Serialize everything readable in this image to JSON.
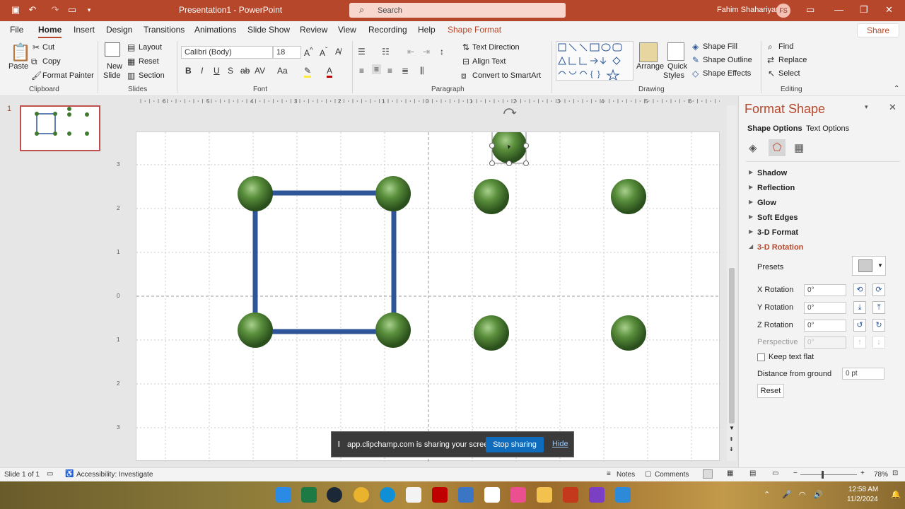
{
  "titlebar": {
    "title": "Presentation1  -  PowerPoint",
    "search_placeholder": "Search",
    "user_name": "Fahim Shahariyar",
    "user_initials": "FS"
  },
  "menu": {
    "tabs": [
      "File",
      "Home",
      "Insert",
      "Design",
      "Transitions",
      "Animations",
      "Slide Show",
      "Review",
      "View",
      "Recording",
      "Help",
      "Shape Format"
    ],
    "share": "Share"
  },
  "ribbon": {
    "clipboard": {
      "paste": "Paste",
      "cut": "Cut",
      "copy": "Copy",
      "format_painter": "Format Painter",
      "group": "Clipboard"
    },
    "slides": {
      "new_slide": "New",
      "new_slide2": "Slide",
      "layout": "Layout",
      "reset": "Reset",
      "section": "Section",
      "group": "Slides"
    },
    "font": {
      "name": "Calibri (Body)",
      "size": "18",
      "group": "Font"
    },
    "paragraph": {
      "text_direction": "Text Direction",
      "align_text": "Align Text",
      "convert_smartart": "Convert to SmartArt",
      "group": "Paragraph"
    },
    "drawing": {
      "arrange": "Arrange",
      "quick_styles": "Quick",
      "quick_styles2": "Styles",
      "shape_fill": "Shape Fill",
      "shape_outline": "Shape Outline",
      "shape_effects": "Shape Effects",
      "group": "Drawing"
    },
    "editing": {
      "find": "Find",
      "replace": "Replace",
      "select": "Select",
      "group": "Editing"
    }
  },
  "thumbnails": {
    "slide_number": "1"
  },
  "rulers": {
    "h_ticks": [
      "6",
      "5",
      "4",
      "3",
      "2",
      "1",
      "0",
      "1",
      "2",
      "3",
      "4",
      "5",
      "6"
    ],
    "v_ticks": [
      "3",
      "2",
      "1",
      "0",
      "1",
      "2",
      "3"
    ]
  },
  "format_pane": {
    "title": "Format Shape",
    "tabs": [
      "Shape Options",
      "Text Options"
    ],
    "sections": [
      "Shadow",
      "Reflection",
      "Glow",
      "Soft Edges",
      "3-D Format",
      "3-D Rotation"
    ],
    "presets_label": "Presets",
    "x_rotation": {
      "label": "X Rotation",
      "value": "0°"
    },
    "y_rotation": {
      "label": "Y Rotation",
      "value": "0°"
    },
    "z_rotation": {
      "label": "Z Rotation",
      "value": "0°"
    },
    "perspective": {
      "label": "Perspective",
      "value": "0°"
    },
    "keep_text_flat": "Keep text flat",
    "distance_label": "Distance from ground",
    "distance_value": "0 pt",
    "reset": "Reset"
  },
  "notification": {
    "message": "app.clipchamp.com is sharing your screen.",
    "stop": "Stop sharing",
    "hide": "Hide"
  },
  "statusbar": {
    "slide_info": "Slide 1 of 1",
    "accessibility": "Accessibility: Investigate",
    "notes": "Notes",
    "comments": "Comments",
    "zoom": "78%"
  },
  "taskbar": {
    "time": "12:58 AM",
    "date": "11/2/2024"
  },
  "colors": {
    "accent": "#b7472a",
    "sphere": "#3f7a2e",
    "connector": "#2e5597",
    "stop_button": "#0f6cbd"
  }
}
